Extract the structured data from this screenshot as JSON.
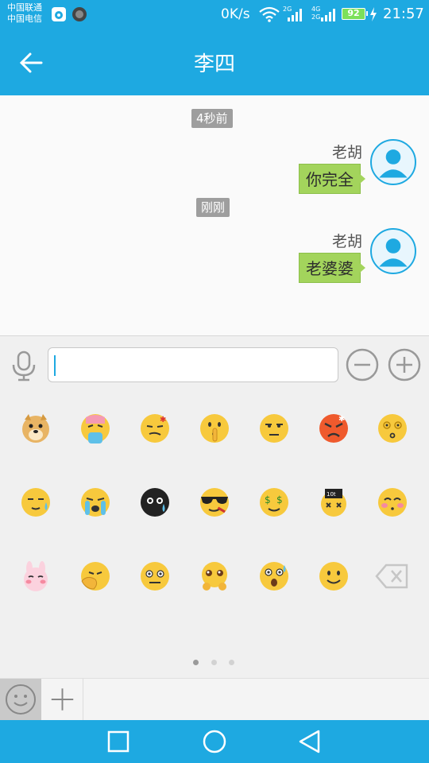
{
  "status_bar": {
    "carrier_1": "中国联通",
    "carrier_2": "中国电信",
    "net_speed": "0K/s",
    "signal_1_label": "2G",
    "signal_2_label": "4G",
    "signal_2b_label": "2G",
    "battery_level": "92",
    "time": "21:57",
    "icons": [
      "weibo-app-icon",
      "game-app-icon",
      "wifi-icon",
      "signal-icon",
      "battery-icon",
      "charging-icon"
    ]
  },
  "header": {
    "title": "李四",
    "back_icon": "back-arrow-icon",
    "accent_color": "#1ea9e1"
  },
  "messages": [
    {
      "time": "4秒前",
      "sender": "老胡",
      "text": "你完全"
    },
    {
      "time": "刚刚",
      "sender": "老胡",
      "text": "老婆婆"
    }
  ],
  "input_bar": {
    "value": "",
    "icons": [
      "microphone-icon",
      "minus-circle-icon",
      "plus-circle-icon"
    ]
  },
  "emoji_panel": {
    "emojis": [
      "doge-emoji",
      "vomit-emoji",
      "dizzy-emoji",
      "shush-emoji",
      "smug-emoji",
      "angry-emoji",
      "confused-emoji",
      "sweat-emoji",
      "crying-emoji",
      "black-sweat-emoji",
      "cool-sunglasses-emoji",
      "money-eyes-emoji",
      "ko-emoji",
      "blush-emoji",
      "rabbit-emoji",
      "facepalm-emoji",
      "awkward-emoji",
      "pleading-emoji",
      "shocked-emoji",
      "smile-emoji",
      "backspace-icon"
    ],
    "page_count": 3,
    "current_page": 1
  },
  "bottom_tabs": [
    "smiley-tab-icon",
    "plus-tab-icon"
  ],
  "nav_bar": [
    "recent-apps-icon",
    "home-icon",
    "back-triangle-icon"
  ]
}
